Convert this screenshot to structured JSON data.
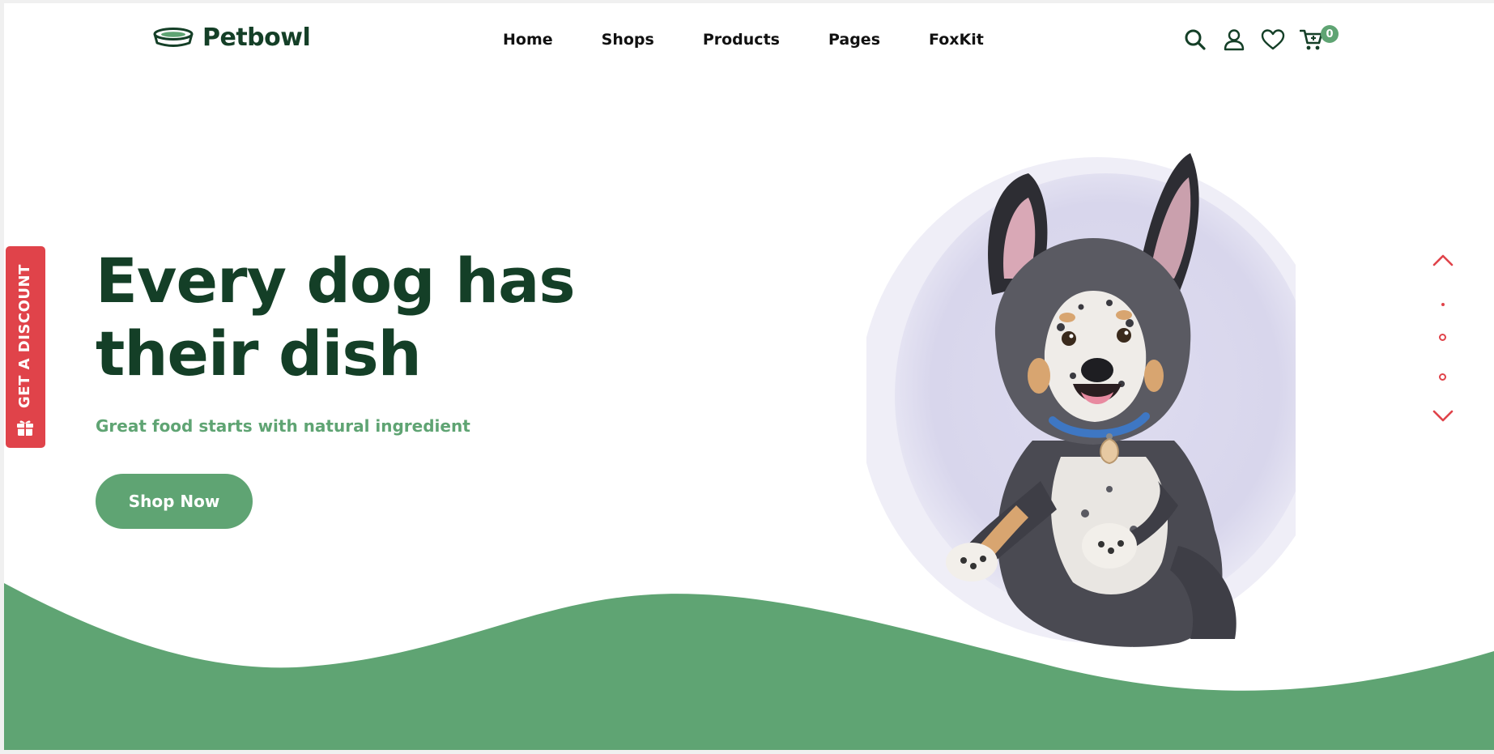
{
  "brand": {
    "name": "Petbowl",
    "logo_icon": "bowl-icon"
  },
  "nav": {
    "items": [
      "Home",
      "Shops",
      "Products",
      "Pages",
      "FoxKit"
    ]
  },
  "header_icons": {
    "search": "search-icon",
    "account": "user-icon",
    "wishlist": "heart-icon",
    "cart": "cart-icon",
    "cart_count": "0"
  },
  "discount_tab": {
    "label": "GET A DISCOUNT",
    "icon": "gift-icon"
  },
  "hero": {
    "title_line1": "Every dog has",
    "title_line2": "their dish",
    "subtitle": "Great food starts with natural ingredient",
    "cta_label": "Shop Now"
  },
  "slider": {
    "slides": 3,
    "active": 1,
    "up_icon": "chevron-up-icon",
    "down_icon": "chevron-down-icon"
  },
  "colors": {
    "primary_dark": "#143f27",
    "primary_green": "#5fa473",
    "accent_red": "#e0434a",
    "circle_bg": "#dcdaee"
  }
}
